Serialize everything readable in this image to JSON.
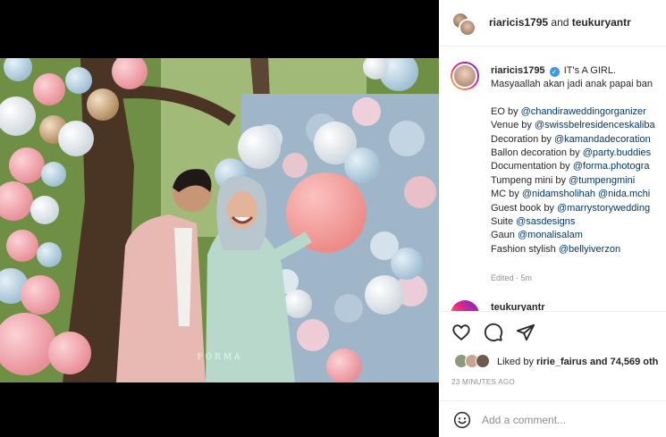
{
  "header": {
    "user1": "riaricis1795",
    "joiner": " and ",
    "user2": "teukuryantr"
  },
  "caption": {
    "username": "riaricis1795",
    "verified_glyph": "✓",
    "title": "IT's A GIRL.",
    "line2": "Masyaallah akan jadi anak papai ban",
    "credits": [
      {
        "label": "EO by ",
        "mention": "@chandiraweddingorganizer"
      },
      {
        "label": "Venue by ",
        "mention": "@swissbelresidenceskaliba"
      },
      {
        "label": "Decoration by ",
        "mention": "@kamandadecoration"
      },
      {
        "label": "Ballon decoration by ",
        "mention": "@party.buddies"
      },
      {
        "label": "Documentation by ",
        "mention": "@forma.photogra"
      },
      {
        "label": "Tumpeng mini by ",
        "mention": "@tumpengmini"
      },
      {
        "label": "MC by ",
        "mention": "@nidamsholihah @nida.mchi"
      },
      {
        "label": "Guest book by ",
        "mention": "@marrystorywedding"
      },
      {
        "label": "Suite ",
        "mention": "@sasdesigns"
      },
      {
        "label": "Gaun ",
        "mention": "@monalisalam"
      },
      {
        "label": "Fashion stylish ",
        "mention": "@bellyiverzon"
      }
    ],
    "edited": "Edited · 5m"
  },
  "next_comment": {
    "text": "teukuryantr"
  },
  "likes": {
    "prefix": "Liked by ",
    "user": "ririe_fairus",
    "suffix": " and 74,569 oth"
  },
  "timestamp": "23 MINUTES AGO",
  "comment_box": {
    "placeholder": "Add a comment..."
  },
  "photo": {
    "watermark": "FORMA"
  },
  "icons": {
    "like": "heart-icon",
    "comment": "comment-bubble-icon",
    "share": "paper-plane-icon",
    "emoji": "smiley-face-icon"
  },
  "colors": {
    "link": "#00376b",
    "verified": "#3897f0",
    "muted": "#8e8e8e",
    "text": "#262626"
  }
}
